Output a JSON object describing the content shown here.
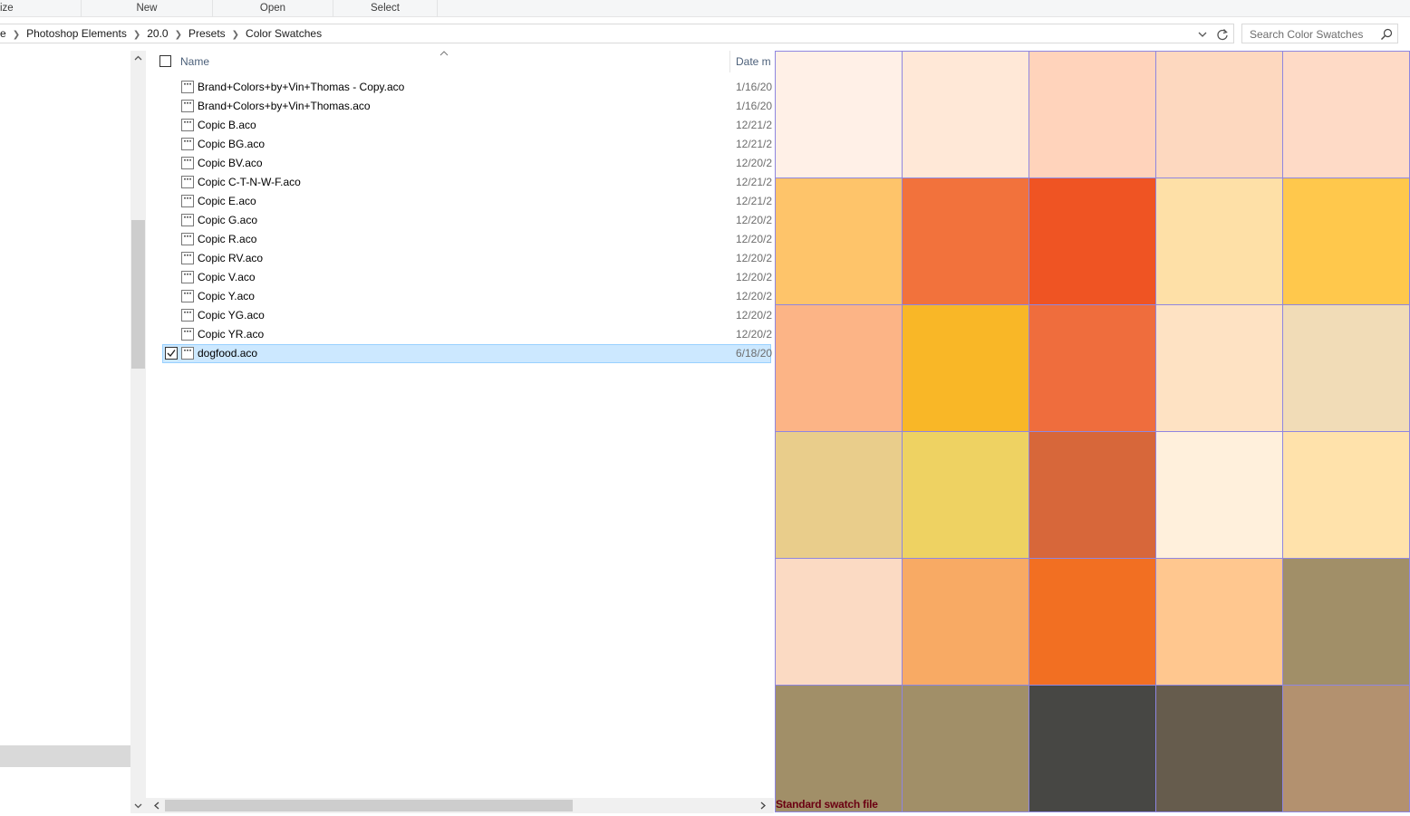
{
  "ribbon": {
    "groups": [
      "ize",
      "New",
      "Open",
      "Select"
    ]
  },
  "address": {
    "breadcrumbs": [
      "e",
      "Photoshop Elements",
      "20.0",
      "Presets",
      "Color Swatches"
    ]
  },
  "search": {
    "placeholder": "Search Color Swatches"
  },
  "filelist": {
    "columns": {
      "name": "Name",
      "date": "Date m"
    },
    "files": [
      {
        "name": "Brand+Colors+by+Vin+Thomas - Copy.aco",
        "date": "1/16/20",
        "selected": false
      },
      {
        "name": "Brand+Colors+by+Vin+Thomas.aco",
        "date": "1/16/20",
        "selected": false
      },
      {
        "name": "Copic B.aco",
        "date": "12/21/2",
        "selected": false
      },
      {
        "name": "Copic BG.aco",
        "date": "12/21/2",
        "selected": false
      },
      {
        "name": "Copic BV.aco",
        "date": "12/20/2",
        "selected": false
      },
      {
        "name": "Copic C-T-N-W-F.aco",
        "date": "12/21/2",
        "selected": false
      },
      {
        "name": "Copic E.aco",
        "date": "12/21/2",
        "selected": false
      },
      {
        "name": "Copic G.aco",
        "date": "12/20/2",
        "selected": false
      },
      {
        "name": "Copic R.aco",
        "date": "12/20/2",
        "selected": false
      },
      {
        "name": "Copic RV.aco",
        "date": "12/20/2",
        "selected": false
      },
      {
        "name": "Copic V.aco",
        "date": "12/20/2",
        "selected": false
      },
      {
        "name": "Copic Y.aco",
        "date": "12/20/2",
        "selected": false
      },
      {
        "name": "Copic YG.aco",
        "date": "12/20/2",
        "selected": false
      },
      {
        "name": "Copic YR.aco",
        "date": "12/20/2",
        "selected": false
      },
      {
        "name": "dogfood.aco",
        "date": "6/18/20",
        "selected": true
      }
    ]
  },
  "preview": {
    "label": "Standard swatch file",
    "swatch_colors": [
      "#fff0e7",
      "#ffe8d7",
      "#ffd3bb",
      "#fdd8bf",
      "#fedac6",
      "#fec46a",
      "#f2723c",
      "#ef5423",
      "#fee0a7",
      "#ffc84c",
      "#fcb486",
      "#f9b727",
      "#ef6d3d",
      "#fee2c3",
      "#f1dcb7",
      "#e9cd8b",
      "#eed262",
      "#d7673a",
      "#fff0dc",
      "#ffe2ab",
      "#fbdac3",
      "#f8aa64",
      "#f26f22",
      "#ffc78f",
      "#a18f68",
      "#a18f68",
      "#a18f68",
      "#474744",
      "#665c4d",
      "#b3916f"
    ]
  },
  "colors": {
    "selection_bg": "#cce8ff",
    "selection_border": "#99d1ff",
    "header_text": "#4c607a",
    "swatch_border": "#8f86e0",
    "preview_label": "#6b0012"
  }
}
